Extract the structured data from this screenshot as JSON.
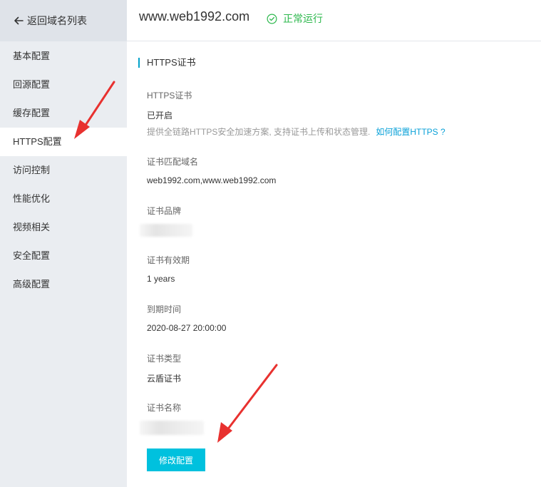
{
  "sidebar": {
    "back_label": "返回域名列表",
    "items": [
      {
        "label": "基本配置"
      },
      {
        "label": "回源配置"
      },
      {
        "label": "缓存配置"
      },
      {
        "label": "HTTPS配置"
      },
      {
        "label": "访问控制"
      },
      {
        "label": "性能优化"
      },
      {
        "label": "视频相关"
      },
      {
        "label": "安全配置"
      },
      {
        "label": "高级配置"
      }
    ],
    "active_item": "HTTPS配置"
  },
  "header": {
    "domain": "www.web1992.com",
    "status_text": "正常运行",
    "status_color": "#2db84d"
  },
  "section": {
    "title": "HTTPS证书",
    "accent_color": "#00a2ca"
  },
  "fields": {
    "https_cert": {
      "label": "HTTPS证书",
      "value": "已开启",
      "description": "提供全链路HTTPS安全加速方案, 支持证书上传和状态管理.",
      "help_link": "如何配置HTTPS ?"
    },
    "matched_domains": {
      "label": "证书匹配域名",
      "value": "web1992.com,www.web1992.com"
    },
    "cert_brand": {
      "label": "证书品牌"
    },
    "validity": {
      "label": "证书有效期",
      "value": "1 years"
    },
    "expiry": {
      "label": "到期时间",
      "value": "2020-08-27 20:00:00"
    },
    "cert_type": {
      "label": "证书类型",
      "value": "云盾证书"
    },
    "cert_name": {
      "label": "证书名称"
    }
  },
  "actions": {
    "edit_label": "修改配置",
    "edit_color": "#00c1de"
  },
  "icons": {
    "back": "arrow-left-icon",
    "status": "check-circle-icon"
  },
  "annotation_color": "#e8312f"
}
